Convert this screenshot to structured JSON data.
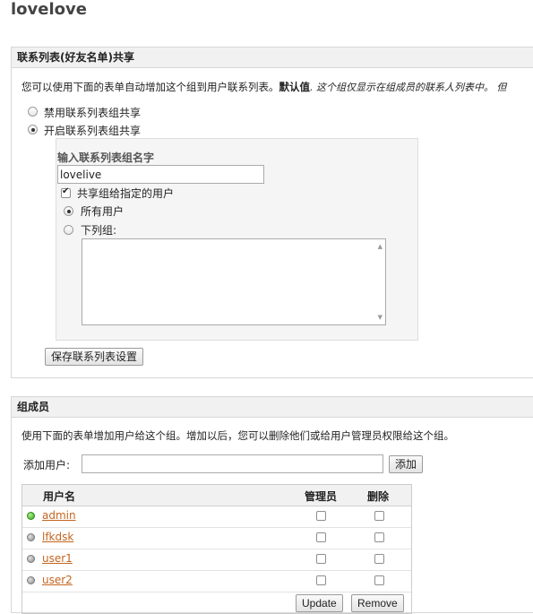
{
  "page": {
    "title": "lovelove"
  },
  "roster_share": {
    "heading": "联系列表(好友名单)共享",
    "desc_normal": "您可以使用下面的表单自动增加这个组到用户联系列表。",
    "desc_bold": "默认值",
    "desc_italic": ". 这个组仅显示在组成员的联系人列表中。  但",
    "disable_label": "禁用联系列表组共享",
    "enable_label": "开启联系列表组共享",
    "enable_selected": true,
    "name_label": "输入联系列表组名字",
    "name_value": "lovelive",
    "share_users_label": "共享组给指定的用户",
    "share_users_checked": true,
    "all_users_label": "所有用户",
    "following_groups_label": "下列组:",
    "save_button": "保存联系列表设置"
  },
  "members": {
    "heading": "组成员",
    "desc": "使用下面的表单增加用户给这个组。增加以后，您可以删除他们或给用户管理员权限给这个组。",
    "add_label": "添加用户:",
    "add_value": "",
    "add_button": "添加",
    "columns": [
      "用户名",
      "管理员",
      "删除"
    ],
    "rows": [
      {
        "name": "admin",
        "status": "online",
        "admin": false,
        "delete": false
      },
      {
        "name": "lfkdsk",
        "status": "offline",
        "admin": false,
        "delete": false
      },
      {
        "name": "user1",
        "status": "offline",
        "admin": false,
        "delete": false
      },
      {
        "name": "user2",
        "status": "offline",
        "admin": false,
        "delete": false
      }
    ],
    "update_button": "Update",
    "remove_button": "Remove"
  },
  "icons": {
    "online": "green-status-dot-icon",
    "offline": "grey-status-dot-icon",
    "scroll_up": "scroll-up-arrow-icon",
    "scroll_down": "scroll-down-arrow-icon"
  },
  "colors": {
    "link": "#c5651f",
    "online": "#3aa321",
    "header_bg": "#f1f1f1"
  }
}
